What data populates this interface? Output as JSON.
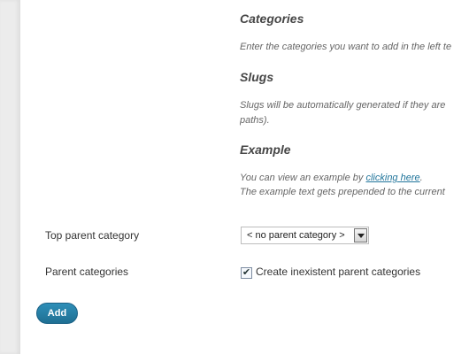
{
  "help": {
    "categories_heading": "Categories",
    "categories_text": "Enter the categories you want to add in the left te",
    "slugs_heading": "Slugs",
    "slugs_text_line1": "Slugs will be automatically generated if they are",
    "slugs_text_line2": "paths).",
    "example_heading": "Example",
    "example_text_prefix": "You can view an example by ",
    "example_link": "clicking here",
    "example_text_suffix": ".",
    "example_text_line2": "The example text gets prepended to the current"
  },
  "form": {
    "top_parent_label": "Top parent category",
    "top_parent_value": "< no parent category >",
    "parent_categories_label": "Parent categories",
    "create_parents_label": "Create inexistent parent categories",
    "create_parents_checked": true,
    "add_button": "Add"
  },
  "colors": {
    "accent": "#21759b",
    "button": "#21759b"
  }
}
